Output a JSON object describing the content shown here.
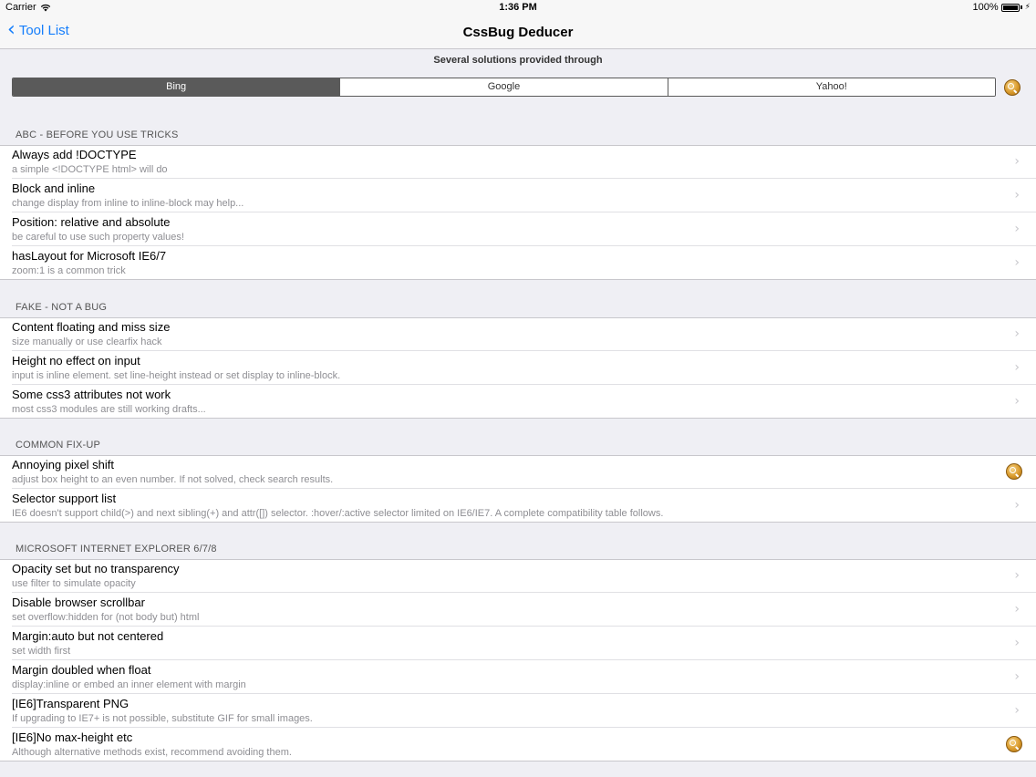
{
  "status_bar": {
    "carrier": "Carrier",
    "time": "1:36 PM",
    "battery": "100%"
  },
  "nav": {
    "back_label": "Tool List",
    "title": "CssBug Deducer"
  },
  "search": {
    "caption": "Several solutions provided through",
    "engines": [
      "Bing",
      "Google",
      "Yahoo!"
    ],
    "selected": "Bing"
  },
  "sections": [
    {
      "header": "ABC - BEFORE YOU USE TRICKS",
      "rows": [
        {
          "title": "Always add !DOCTYPE",
          "subtitle": "a simple <!DOCTYPE html> will do",
          "accessory": "chevron"
        },
        {
          "title": "Block and inline",
          "subtitle": "change display from inline to inline-block may help...",
          "accessory": "chevron"
        },
        {
          "title": "Position: relative and absolute",
          "subtitle": "be careful to use such property values!",
          "accessory": "chevron"
        },
        {
          "title": "hasLayout for Microsoft IE6/7",
          "subtitle": "zoom:1 is a common trick",
          "accessory": "chevron"
        }
      ]
    },
    {
      "header": "FAKE - NOT A BUG",
      "rows": [
        {
          "title": "Content floating and miss size",
          "subtitle": "size manually or use clearfix hack",
          "accessory": "chevron"
        },
        {
          "title": "Height no effect on input",
          "subtitle": "input is inline element. set line-height instead or set display to inline-block.",
          "accessory": "chevron"
        },
        {
          "title": "Some css3 attributes not work",
          "subtitle": "most css3 modules are still working drafts...",
          "accessory": "chevron"
        }
      ]
    },
    {
      "header": "COMMON FIX-UP",
      "rows": [
        {
          "title": "Annoying pixel shift",
          "subtitle": "adjust box height to an even number. If not solved, check search results.",
          "accessory": "search"
        },
        {
          "title": "Selector support list",
          "subtitle": "IE6 doesn't support child(>) and next sibling(+) and attr([]) selector. :hover/:active selector limited on IE6/IE7. A complete compatibility table follows.",
          "accessory": "chevron"
        }
      ]
    },
    {
      "header": "MICROSOFT INTERNET EXPLORER 6/7/8",
      "rows": [
        {
          "title": "Opacity set but no transparency",
          "subtitle": "use filter to simulate opacity",
          "accessory": "chevron"
        },
        {
          "title": "Disable browser scrollbar",
          "subtitle": "set overflow:hidden for (not body but) html",
          "accessory": "chevron"
        },
        {
          "title": "Margin:auto but not centered",
          "subtitle": "set width first",
          "accessory": "chevron"
        },
        {
          "title": "Margin doubled when float",
          "subtitle": "display:inline or embed an inner element with margin",
          "accessory": "chevron"
        },
        {
          "title": "[IE6]Transparent PNG",
          "subtitle": "If upgrading to IE7+ is not possible, substitute GIF for small images.",
          "accessory": "chevron"
        },
        {
          "title": "[IE6]No max-height etc",
          "subtitle": "Although alternative methods exist, recommend avoiding them.",
          "accessory": "search"
        }
      ]
    }
  ]
}
